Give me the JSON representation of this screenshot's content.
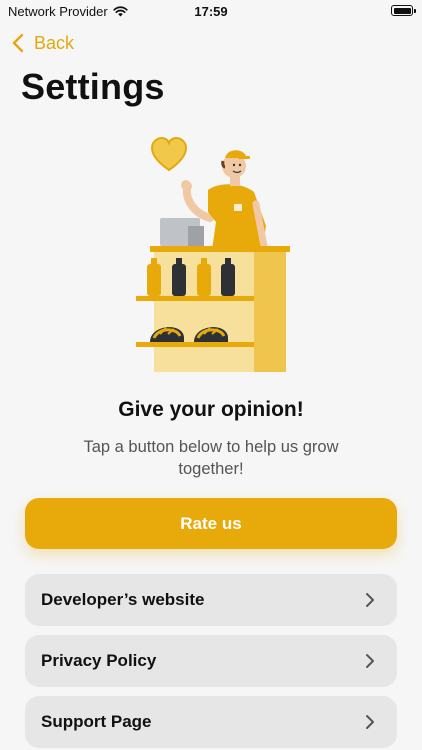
{
  "status_bar": {
    "carrier": "Network Provider",
    "time": "17:59",
    "icons": [
      "wifi-icon",
      "battery-icon"
    ]
  },
  "nav": {
    "back_label": "Back",
    "back_icon": "chevron-left-icon"
  },
  "page": {
    "title": "Settings"
  },
  "promo": {
    "illustration": "shop-clerk-illustration",
    "heading": "Give your opinion!",
    "subtitle": "Tap a button below to help us grow together!",
    "rate_button_label": "Rate us"
  },
  "links": [
    {
      "label": "Developer’s website",
      "icon": "chevron-right-icon"
    },
    {
      "label": "Privacy Policy",
      "icon": "chevron-right-icon"
    },
    {
      "label": "Support Page",
      "icon": "chevron-right-icon"
    }
  ],
  "colors": {
    "accent": "#e8a90a",
    "background": "#f6f6f6",
    "row_background": "#e6e6e6"
  }
}
